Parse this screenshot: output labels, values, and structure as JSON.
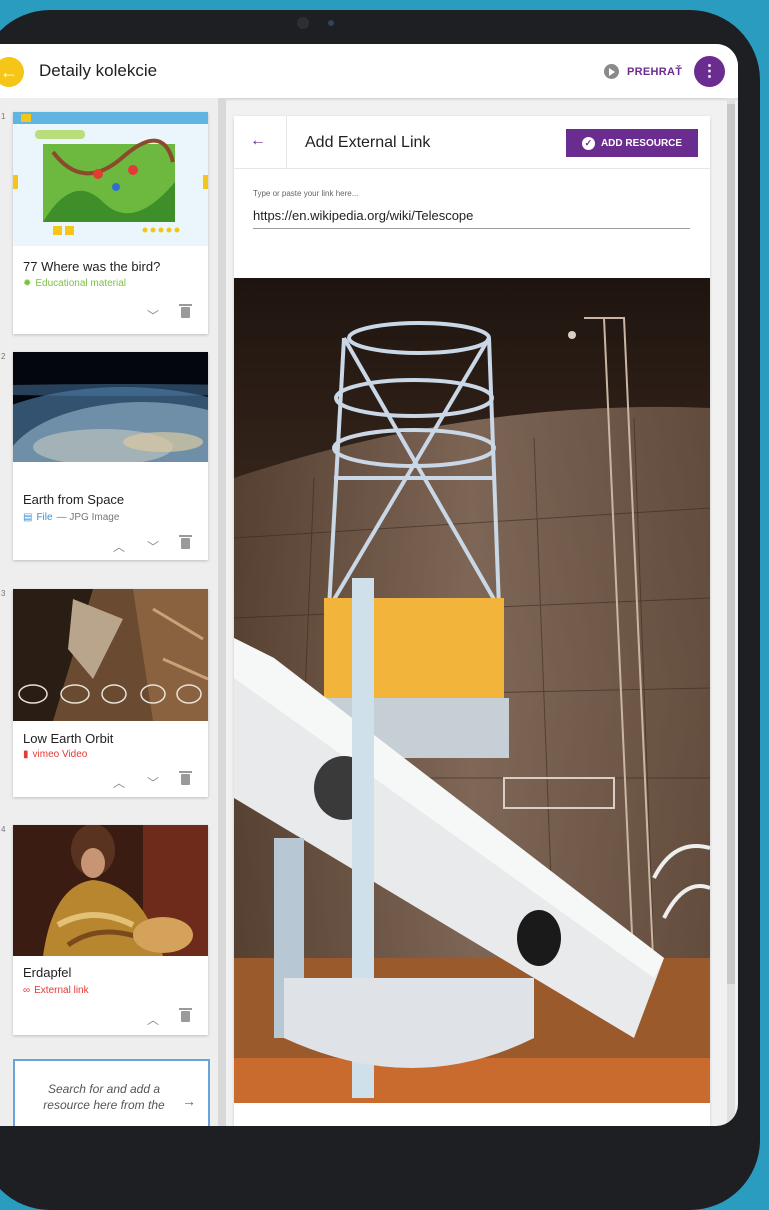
{
  "appbar": {
    "title": "Detaily kolekcie",
    "play_label": "PREHRAŤ"
  },
  "collection": [
    {
      "number": "1",
      "title": "77 Where was the bird?",
      "type": "Educational material",
      "type_icon": "puzzle-icon",
      "color": "#7cc242"
    },
    {
      "number": "2",
      "title": "Earth from Space",
      "type": "File",
      "type_detail": "— JPG Image",
      "type_icon": "file-icon",
      "color": "#3b8fd9"
    },
    {
      "number": "3",
      "title": "Low Earth Orbit",
      "type": "vimeo Video",
      "type_icon": "video-icon",
      "color": "#e53935"
    },
    {
      "number": "4",
      "title": "Erdapfel",
      "type": "External link",
      "type_icon": "link-icon",
      "color": "#e53935"
    }
  ],
  "search_card": {
    "text": "Search for and add a resource here from the"
  },
  "panel": {
    "title": "Add External Link",
    "add_button_label": "ADD RESOURCE",
    "input_label": "Type or paste your link here...",
    "input_value": "https://en.wikipedia.org/wiki/Telescope"
  },
  "colors": {
    "accent": "#6b2c8f",
    "back_button": "#f5c518"
  }
}
